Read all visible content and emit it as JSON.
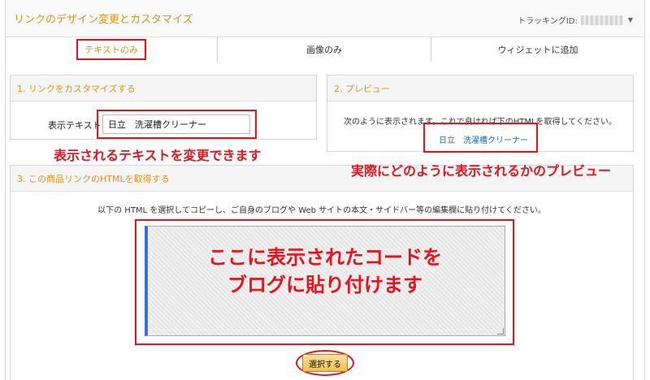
{
  "header": {
    "title": "リンクのデザイン変更とカスタマイズ",
    "tracking_label": "トラッキングID:"
  },
  "tabs": [
    {
      "label": "テキストのみ",
      "active": true
    },
    {
      "label": "画像のみ",
      "active": false
    },
    {
      "label": "ウィジェットに追加",
      "active": false
    }
  ],
  "customize": {
    "title": "1. リンクをカスタマイズする",
    "field_label": "表示テキスト",
    "field_value": "日立　洗濯槽クリーナー"
  },
  "preview": {
    "title": "2. プレビュー",
    "message": "次のように表示されます。これで良ければ下のHTMLを取得してください。",
    "link_text": "日立　洗濯槽クリーナー"
  },
  "html_section": {
    "title": "3. この商品リンクのHTMLを取得する",
    "description": "以下の HTML を選択してコピーし、ご自身のブログや Web サイトの本文・サイドバー等の編集欄に貼り付けてください。",
    "select_button": "選択する"
  },
  "annotations": {
    "text_change": "表示されるテキストを変更できます",
    "preview_note": "実際にどのように表示されるかのプレビュー",
    "code_line1": "ここに表示されたコードを",
    "code_line2": "ブログに貼り付けます"
  },
  "colors": {
    "accent": "#e3931a",
    "annotation": "#e8141d",
    "link": "#1a6fa8",
    "button": "#f0c14b"
  }
}
